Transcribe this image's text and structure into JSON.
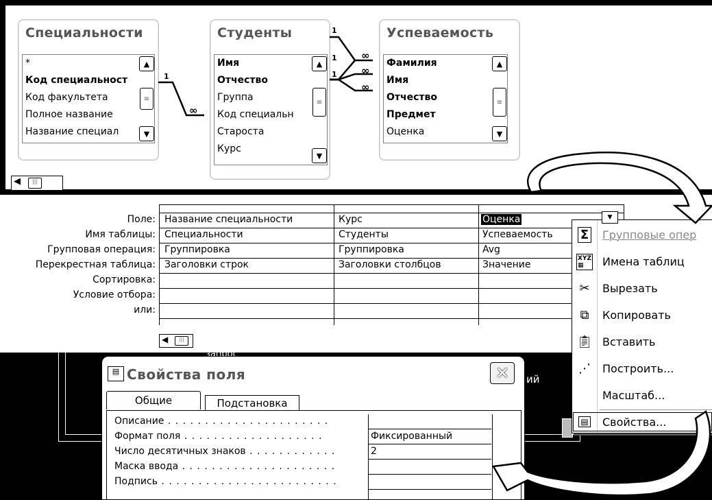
{
  "relationships": {
    "tables": [
      {
        "title": "Специальности",
        "fields": [
          {
            "label": "*",
            "bold": false
          },
          {
            "label": "Код специальност",
            "bold": true
          },
          {
            "label": "Код факультета",
            "bold": false
          },
          {
            "label": "Полное название",
            "bold": false
          },
          {
            "label": "Название специал",
            "bold": false
          }
        ]
      },
      {
        "title": "Студенты",
        "fields": [
          {
            "label": "Имя",
            "bold": true
          },
          {
            "label": "Отчество",
            "bold": true
          },
          {
            "label": "Группа",
            "bold": false
          },
          {
            "label": "Код специальн",
            "bold": false
          },
          {
            "label": "Староста",
            "bold": false
          },
          {
            "label": "Курс",
            "bold": false
          }
        ]
      },
      {
        "title": "Успеваемость",
        "fields": [
          {
            "label": "Фамилия",
            "bold": true
          },
          {
            "label": "Имя",
            "bold": true
          },
          {
            "label": "Отчество",
            "bold": true
          },
          {
            "label": "Предмет",
            "bold": true
          },
          {
            "label": "Оценка",
            "bold": false
          }
        ]
      }
    ],
    "link_one": "1",
    "link_many": "∞"
  },
  "grid": {
    "row_labels": [
      "Поле:",
      "Имя таблицы:",
      "Групповая операция:",
      "Перекрестная таблица:",
      "Сортировка:",
      "Условие отбора:",
      "или:"
    ],
    "columns": [
      {
        "field": "Название специальности",
        "table": "Специальности",
        "group": "Группировка",
        "crosstab": "Заголовки строк"
      },
      {
        "field": "Курс",
        "table": "Студенты",
        "group": "Группировка",
        "crosstab": "Заголовки столбцов"
      },
      {
        "field": "Оценка",
        "table": "Успеваемость",
        "group": "Avg",
        "crosstab": "Значение"
      }
    ]
  },
  "context_menu": {
    "items": [
      {
        "label": "Групповые опер",
        "icon": "sigma-icon",
        "disabled": true
      },
      {
        "label": "Имена таблиц",
        "icon": "table-names-icon",
        "disabled": false
      },
      {
        "label": "Вырезать",
        "icon": "scissors-icon",
        "disabled": false
      },
      {
        "label": "Копировать",
        "icon": "copy-icon",
        "disabled": false
      },
      {
        "label": "Вставить",
        "icon": "paste-icon",
        "disabled": false
      },
      {
        "label": "Построить...",
        "icon": "wand-icon",
        "disabled": false
      },
      {
        "label": "Масштаб...",
        "icon": "",
        "disabled": false
      },
      {
        "label": "Свойства...",
        "icon": "properties-icon",
        "disabled": false,
        "selected": true
      }
    ]
  },
  "background_window": {
    "partial_text": "ий",
    "partial_top": "запрос"
  },
  "property_sheet": {
    "title": "Свойства поля",
    "tabs": [
      "Общие",
      "Подстановка"
    ],
    "rows": [
      {
        "label": "Описание",
        "value": ""
      },
      {
        "label": "Формат поля",
        "value": "Фиксированный"
      },
      {
        "label": "Число десятичных знаков",
        "value": "2"
      },
      {
        "label": "Маска ввода",
        "value": ""
      },
      {
        "label": "Подпись",
        "value": ""
      }
    ]
  }
}
